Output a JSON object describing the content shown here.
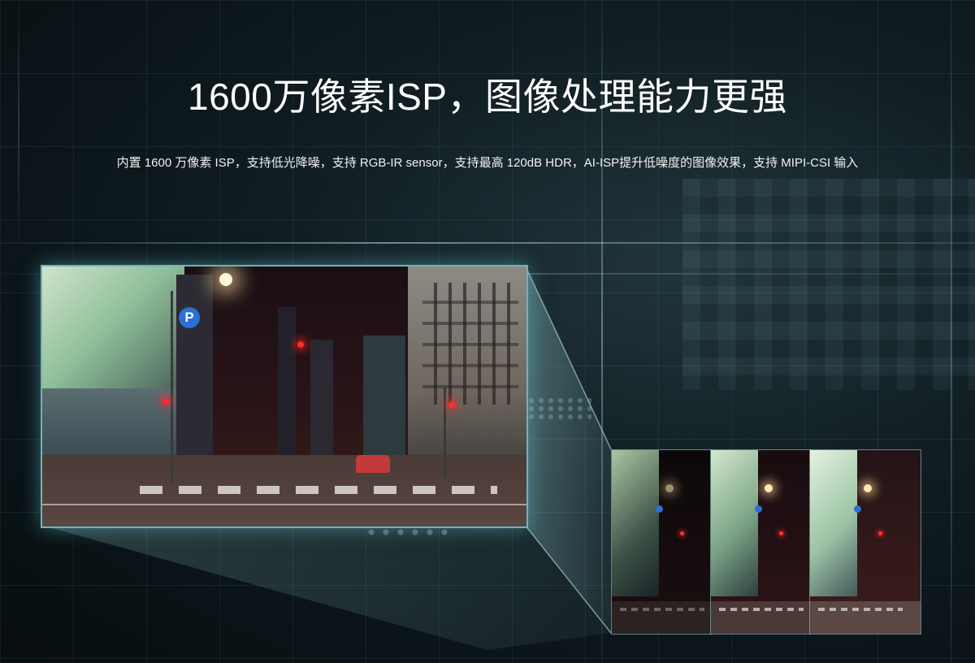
{
  "headline": "1600万像素ISP，图像处理能力更强",
  "description": "内置 1600 万像素 ISP，支持低光降噪，支持 RGB-IR sensor，支持最高 120dB HDR，AI-ISP提升低噪度的图像效果，支持 MIPI-CSI 输入",
  "scene": {
    "parking_sign": "P"
  },
  "colors": {
    "accent_frame": "#6fb3bd",
    "background": "#0f1c21",
    "traffic_red": "#ff2a2a",
    "parking_blue": "#2a6fd1"
  },
  "icons": [
    "parking-sign-icon"
  ]
}
